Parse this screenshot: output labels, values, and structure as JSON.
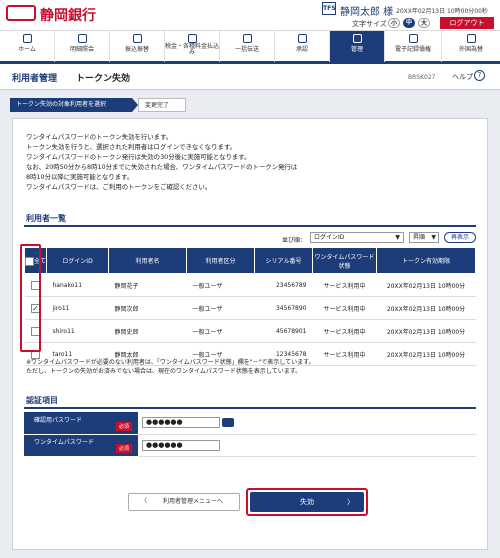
{
  "header": {
    "bank_name": "静岡銀行",
    "user_icon_text": "TFS",
    "user_name": "静岡太郎 様",
    "last_login": "20XX年02月13日 10時00分00秒",
    "font_size_label": "文字サイズ",
    "font_sizes": [
      "小",
      "中",
      "大"
    ],
    "logout_label": "ログアウト"
  },
  "nav": {
    "items": [
      {
        "label": "ホーム",
        "icon": "home-icon"
      },
      {
        "label": "明細照会",
        "icon": "document-icon"
      },
      {
        "label": "振込振替",
        "icon": "transfer-icon"
      },
      {
        "label": "税金・各種料金払込み",
        "icon": "tax-icon"
      },
      {
        "label": "一括伝送",
        "icon": "batch-icon"
      },
      {
        "label": "承認",
        "icon": "approval-icon"
      },
      {
        "label": "管理",
        "icon": "admin-icon"
      },
      {
        "label": "電子記録債権",
        "icon": "e-bond-icon"
      },
      {
        "label": "外国為替",
        "icon": "forex-icon"
      }
    ],
    "active": "管理"
  },
  "page": {
    "section": "利用者管理",
    "title": "トークン失効",
    "code": "BRSK027",
    "help_label": "ヘルプ",
    "help_icon": "?"
  },
  "steps": [
    "トークン失効の対象利用者を選択",
    "変更完了"
  ],
  "description": [
    "ワンタイムパスワードのトークン失効を行います。",
    "トークン失効を行うと、選択された利用者はログインできなくなります。",
    "ワンタイムパスワードのトークン発行は失効の30分後に実施可能となります。",
    "なお、20時50分から8時10分までに失効された場合、ワンタイムパスワードのトークン発行は",
    "8時10分以降に実施可能となります。",
    "ワンタイムパスワードは、ご利用のトークンをご確認ください。"
  ],
  "user_list": {
    "title": "利用者一覧",
    "sort_label": "並び順：",
    "sort_value": "ログインID",
    "order_value": "昇順",
    "resort_label": "再表示",
    "columns": [
      "全て",
      "ログインID",
      "利用者名",
      "利用者区分",
      "シリアル番号",
      "ワンタイムパスワード状態",
      "トークン有効期限"
    ],
    "rows": [
      {
        "checked": false,
        "login_id": "hanako11",
        "name": "静岡花子",
        "category": "一般ユーザ",
        "serial": "23456789",
        "status": "サービス利用中",
        "expiry": "20XX年02月13日 10時00分"
      },
      {
        "checked": true,
        "login_id": "jiro11",
        "name": "静岡次郎",
        "category": "一般ユーザ",
        "serial": "34567890",
        "status": "サービス利用中",
        "expiry": "20XX年02月13日 10時00分"
      },
      {
        "checked": false,
        "login_id": "shiro11",
        "name": "静岡史郎",
        "category": "一般ユーザ",
        "serial": "45678901",
        "status": "サービス利用中",
        "expiry": "20XX年02月13日 10時00分"
      },
      {
        "checked": false,
        "login_id": "taro11",
        "name": "静岡太郎",
        "category": "一般ユーザ",
        "serial": "12345678",
        "status": "サービス利用中",
        "expiry": "20XX年02月13日 10時00分"
      }
    ],
    "notes": [
      "※ワンタイムパスワードが必要のない利用者は、「ワンタイムパスワード状態」欄を\"－\"で表示しています。",
      "ただし、トークンの失効がお済みでない場合は、現在のワンタイムパスワード状態を表示しています。"
    ]
  },
  "auth": {
    "title": "認証項目",
    "required_label": "必須",
    "fields": [
      {
        "label": "確認用パスワード",
        "value": "●●●●●●"
      },
      {
        "label": "ワンタイムパスワード",
        "value": "●●●●●●"
      }
    ]
  },
  "buttons": {
    "back_label": "利用者管理メニューへ",
    "exec_label": "失効"
  },
  "colors": {
    "brand": "#c8102e",
    "navy": "#1d3d7a"
  }
}
